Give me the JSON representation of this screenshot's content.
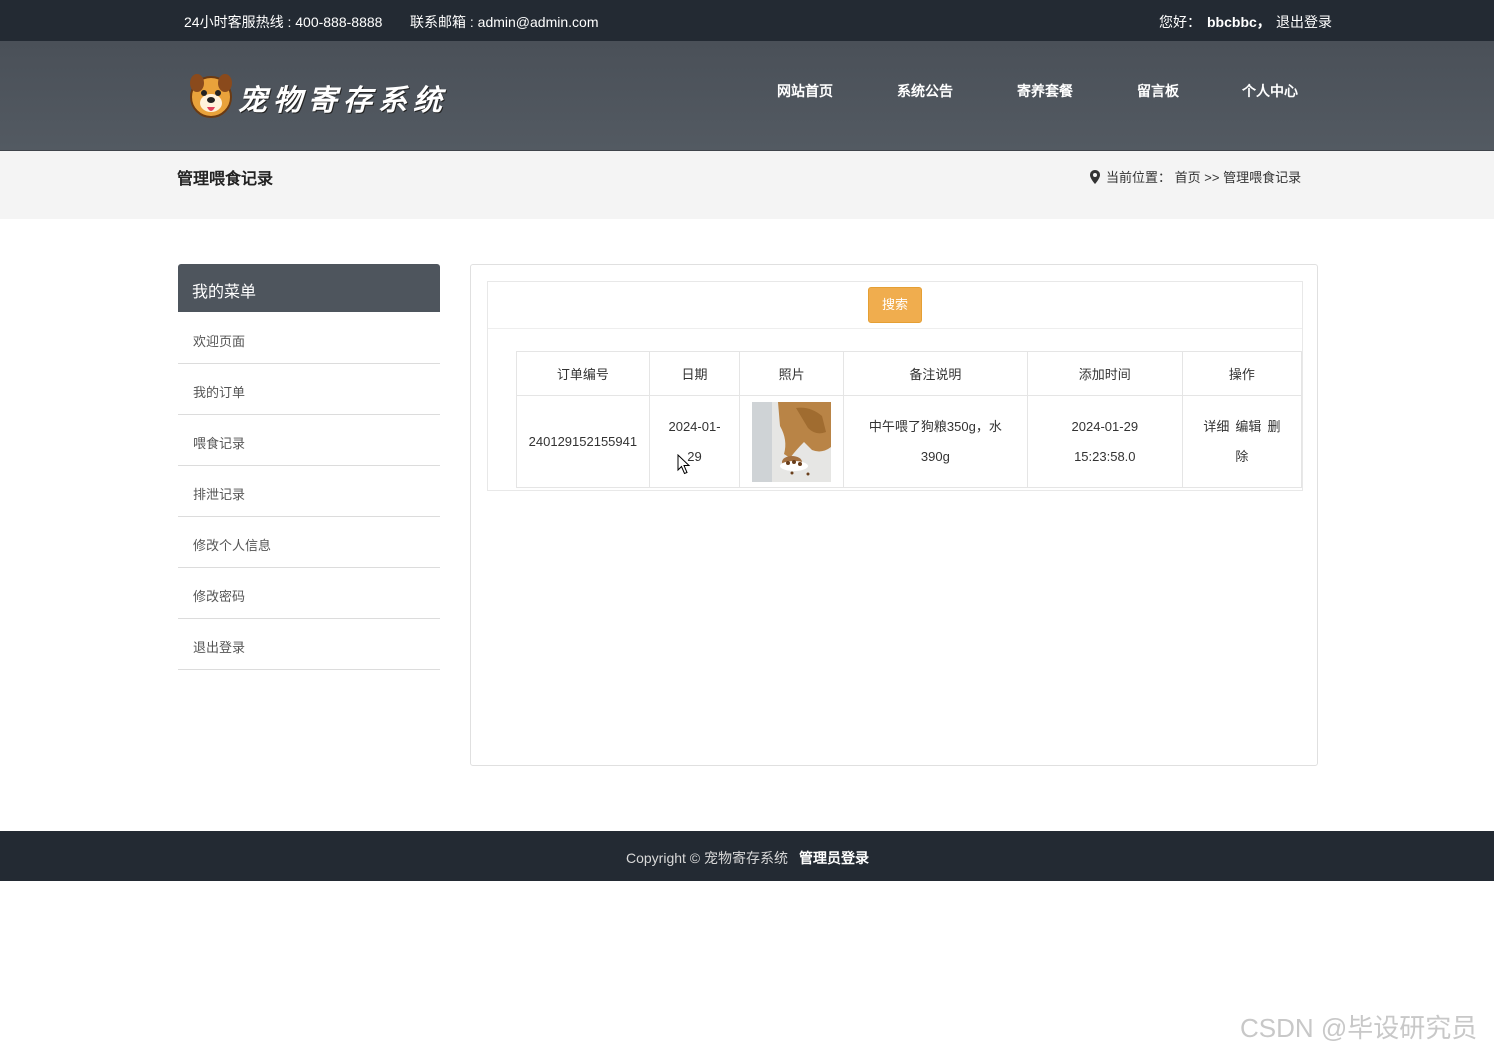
{
  "topbar": {
    "hotline": "24小时客服热线 : 400-888-8888",
    "email": "联系邮箱 : admin@admin.com",
    "greeting": "您好：",
    "username": "bbcbbc，",
    "logout": "退出登录"
  },
  "header": {
    "logo_text": "宠物寄存系统",
    "nav": [
      "网站首页",
      "系统公告",
      "寄养套餐",
      "留言板",
      "个人中心"
    ]
  },
  "band": {
    "title": "管理喂食记录",
    "location_label": "当前位置：",
    "home": "首页",
    "separator": ">>",
    "current": "管理喂食记录"
  },
  "sidebar": {
    "title": "我的菜单",
    "items": [
      "欢迎页面",
      "我的订单",
      "喂食记录",
      "排泄记录",
      "修改个人信息",
      "修改密码",
      "退出登录"
    ]
  },
  "main": {
    "search_label": "搜索",
    "table": {
      "headers": [
        "订单编号",
        "日期",
        "照片",
        "备注说明",
        "添加时间",
        "操作"
      ],
      "rows": [
        {
          "order_no": "240129152155941",
          "date_line1": "2024-01-",
          "date_line2": "29",
          "photo": "dog-eating-photo",
          "note_line1": "中午喂了狗粮350g，水",
          "note_line2": "390g",
          "added_line1": "2024-01-29",
          "added_line2": "15:23:58.0",
          "actions": [
            "详细",
            "编辑",
            "删",
            "除"
          ]
        }
      ]
    }
  },
  "footer": {
    "copyright": "Copyright © 宠物寄存系统",
    "admin_login": "管理员登录"
  },
  "watermark": "CSDN @毕设研究员",
  "colors": {
    "topbar": "#232a33",
    "header": "#4e555d",
    "search_button": "#f0ad4e",
    "band": "#f4f4f4"
  }
}
